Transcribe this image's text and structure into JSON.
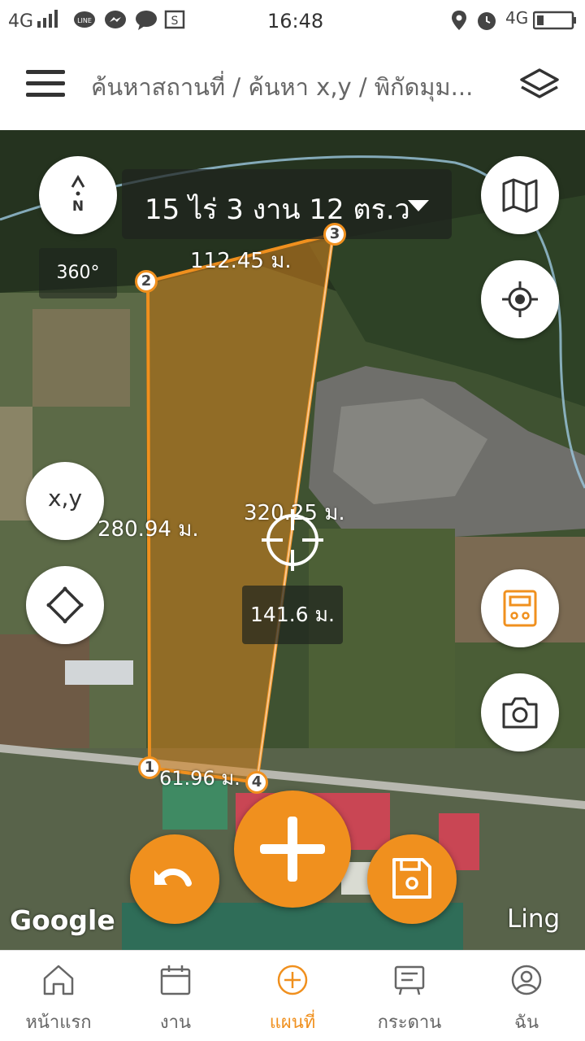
{
  "status_bar": {
    "network_left": "4G",
    "time": "16:48",
    "network_right": "4G"
  },
  "header": {
    "title": "ค้นหาสถานที่ / ค้นหา x,y / พิกัดมุม...",
    "menu_icon": "hamburger-icon",
    "layers_icon": "layers-icon"
  },
  "map": {
    "area_text": "15 ไร่ 3 งาน 12 ตร.ว",
    "compass_letter": "N",
    "rotation": "360°",
    "xy_label": "x,y",
    "segments": {
      "top": "112.45 ม.",
      "left": "280.94 ม.",
      "right": "320.25 ม.",
      "bottom": "61.96 ม."
    },
    "crosshair_distance": "141.6 ม.",
    "vertices": [
      "1",
      "2",
      "3",
      "4"
    ],
    "attribution": "Google",
    "watermark": "Ling",
    "accent_color": "#f0901e"
  },
  "bottom_nav": {
    "items": [
      {
        "label": "หน้าแรก",
        "icon": "home-icon"
      },
      {
        "label": "งาน",
        "icon": "calendar-icon"
      },
      {
        "label": "แผนที่",
        "icon": "plus-circle-icon"
      },
      {
        "label": "กระดาน",
        "icon": "board-icon"
      },
      {
        "label": "ฉัน",
        "icon": "profile-icon"
      }
    ],
    "active_index": 2
  }
}
